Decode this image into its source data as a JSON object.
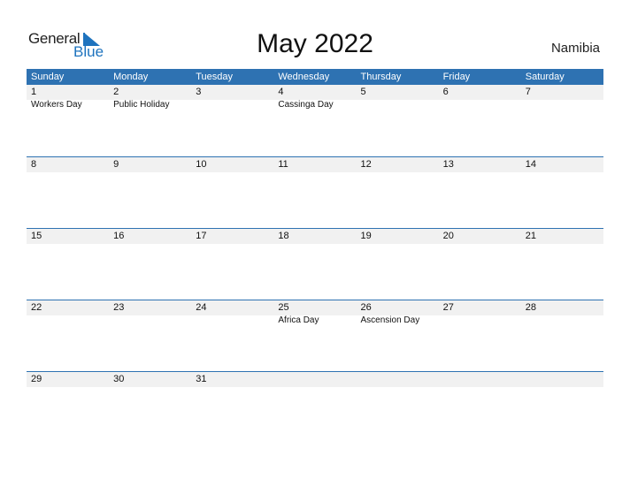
{
  "logo": {
    "general": "General",
    "blue": "Blue"
  },
  "title": "May 2022",
  "country": "Namibia",
  "colors": {
    "accent": "#2e72b2",
    "band": "#f1f1f1"
  },
  "weekdays": [
    "Sunday",
    "Monday",
    "Tuesday",
    "Wednesday",
    "Thursday",
    "Friday",
    "Saturday"
  ],
  "weeks": [
    [
      {
        "day": "1",
        "holiday": "Workers Day"
      },
      {
        "day": "2",
        "holiday": "Public Holiday"
      },
      {
        "day": "3",
        "holiday": ""
      },
      {
        "day": "4",
        "holiday": "Cassinga Day"
      },
      {
        "day": "5",
        "holiday": ""
      },
      {
        "day": "6",
        "holiday": ""
      },
      {
        "day": "7",
        "holiday": ""
      }
    ],
    [
      {
        "day": "8",
        "holiday": ""
      },
      {
        "day": "9",
        "holiday": ""
      },
      {
        "day": "10",
        "holiday": ""
      },
      {
        "day": "11",
        "holiday": ""
      },
      {
        "day": "12",
        "holiday": ""
      },
      {
        "day": "13",
        "holiday": ""
      },
      {
        "day": "14",
        "holiday": ""
      }
    ],
    [
      {
        "day": "15",
        "holiday": ""
      },
      {
        "day": "16",
        "holiday": ""
      },
      {
        "day": "17",
        "holiday": ""
      },
      {
        "day": "18",
        "holiday": ""
      },
      {
        "day": "19",
        "holiday": ""
      },
      {
        "day": "20",
        "holiday": ""
      },
      {
        "day": "21",
        "holiday": ""
      }
    ],
    [
      {
        "day": "22",
        "holiday": ""
      },
      {
        "day": "23",
        "holiday": ""
      },
      {
        "day": "24",
        "holiday": ""
      },
      {
        "day": "25",
        "holiday": "Africa Day"
      },
      {
        "day": "26",
        "holiday": "Ascension Day"
      },
      {
        "day": "27",
        "holiday": ""
      },
      {
        "day": "28",
        "holiday": ""
      }
    ],
    [
      {
        "day": "29",
        "holiday": ""
      },
      {
        "day": "30",
        "holiday": ""
      },
      {
        "day": "31",
        "holiday": ""
      },
      {
        "day": "",
        "holiday": ""
      },
      {
        "day": "",
        "holiday": ""
      },
      {
        "day": "",
        "holiday": ""
      },
      {
        "day": "",
        "holiday": ""
      }
    ]
  ]
}
